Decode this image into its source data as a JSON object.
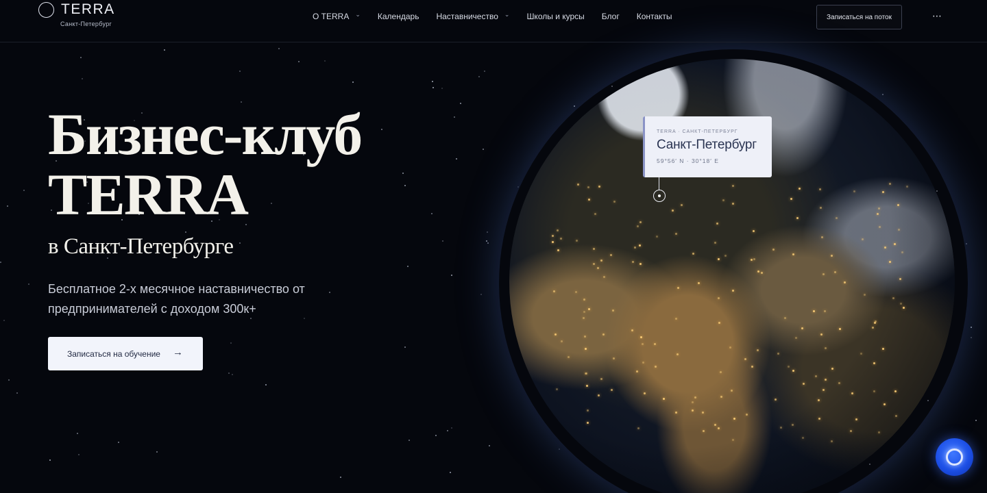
{
  "brand": {
    "name": "TERRA",
    "city": "Санкт-Петербург"
  },
  "nav": {
    "items": [
      {
        "label": "О TERRA",
        "dropdown": true
      },
      {
        "label": "Календарь",
        "dropdown": false
      },
      {
        "label": "Наставничество",
        "dropdown": true
      },
      {
        "label": "Школы и курсы",
        "dropdown": false
      },
      {
        "label": "Блог",
        "dropdown": false
      },
      {
        "label": "Контакты",
        "dropdown": false
      }
    ],
    "chevron": "⌄",
    "cta": "Записаться на поток",
    "more": "⋯"
  },
  "hero": {
    "title_line1": "Бизнес-клуб",
    "title_line2": "TERRA",
    "subtitle": "в Санкт-Петербурге",
    "description": "Бесплатное 2-х месячное наставничество от предпринимателей с доходом 300к+",
    "button_label": "Записаться на обучение",
    "button_arrow": "→"
  },
  "location_card": {
    "meta": "TERRA · САНКТ-ПЕТЕРБУРГ",
    "city": "Санкт-Петербург",
    "coords": "59°56′ N · 30°18′ E"
  },
  "colors": {
    "background": "#05070d",
    "accent_blue": "#1c4fe6",
    "card_background": "#eef0f8"
  },
  "icons": [
    "logo-ring-icon",
    "chevron-down-icon",
    "more-dots-icon",
    "arrow-right-icon",
    "location-pin-icon",
    "chat-icon"
  ]
}
